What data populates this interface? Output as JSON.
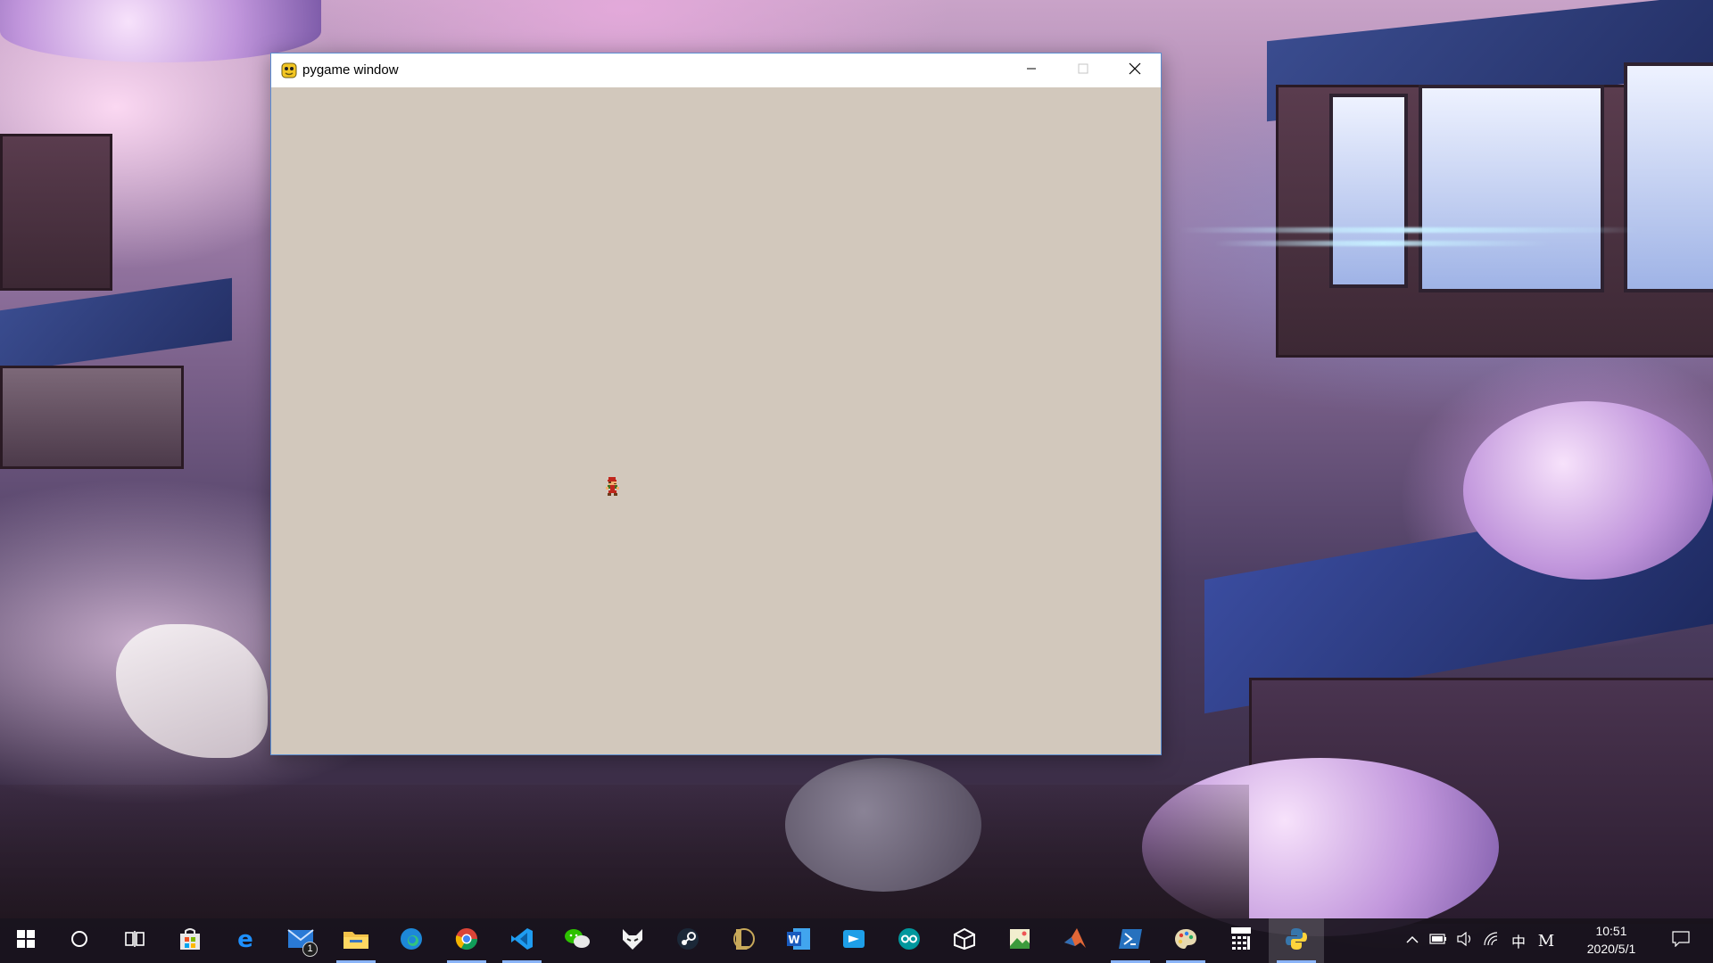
{
  "window": {
    "title": "pygame window",
    "canvas_color": "#d2c8bc",
    "border_color": "#5b8ed1"
  },
  "titlebar_controls": {
    "minimize_icon": "minimize-icon",
    "maximize_icon": "maximize-icon",
    "close_icon": "close-icon"
  },
  "game": {
    "sprite": "mario-sprite"
  },
  "taskbar": {
    "start_icon": "windows-logo-icon",
    "search_icon": "search-circle-icon",
    "task_view_icon": "task-view-icon",
    "pinned": [
      {
        "name": "Microsoft Store",
        "icon": "store-icon"
      },
      {
        "name": "Internet Explorer",
        "icon": "ie-icon"
      },
      {
        "name": "Mail",
        "icon": "mail-icon",
        "badge": "1"
      },
      {
        "name": "File Explorer",
        "icon": "folder-icon"
      },
      {
        "name": "Microsoft Edge",
        "icon": "edge-icon"
      },
      {
        "name": "Google Chrome",
        "icon": "chrome-icon"
      },
      {
        "name": "Visual Studio Code",
        "icon": "vscode-icon"
      },
      {
        "name": "WeChat",
        "icon": "wechat-icon"
      },
      {
        "name": "Fox app",
        "icon": "fox-icon"
      },
      {
        "name": "Steam",
        "icon": "steam-icon"
      },
      {
        "name": "League of Legends",
        "icon": "lol-icon"
      },
      {
        "name": "Word",
        "icon": "word-icon"
      },
      {
        "name": "Send app",
        "icon": "send-icon"
      },
      {
        "name": "Arduino",
        "icon": "arduino-icon"
      },
      {
        "name": "Unity",
        "icon": "unity-icon"
      },
      {
        "name": "Image app",
        "icon": "image-icon"
      },
      {
        "name": "MATLAB",
        "icon": "matlab-icon"
      },
      {
        "name": "PowerShell",
        "icon": "powershell-icon"
      },
      {
        "name": "Paint",
        "icon": "paint-icon"
      },
      {
        "name": "Calculator",
        "icon": "calculator-icon"
      },
      {
        "name": "Python",
        "icon": "python-icon"
      }
    ],
    "accent": "#8ab4f8"
  },
  "tray": {
    "ime": "中",
    "input_mode": "M",
    "time": "10:51",
    "date": "2020/5/1"
  }
}
